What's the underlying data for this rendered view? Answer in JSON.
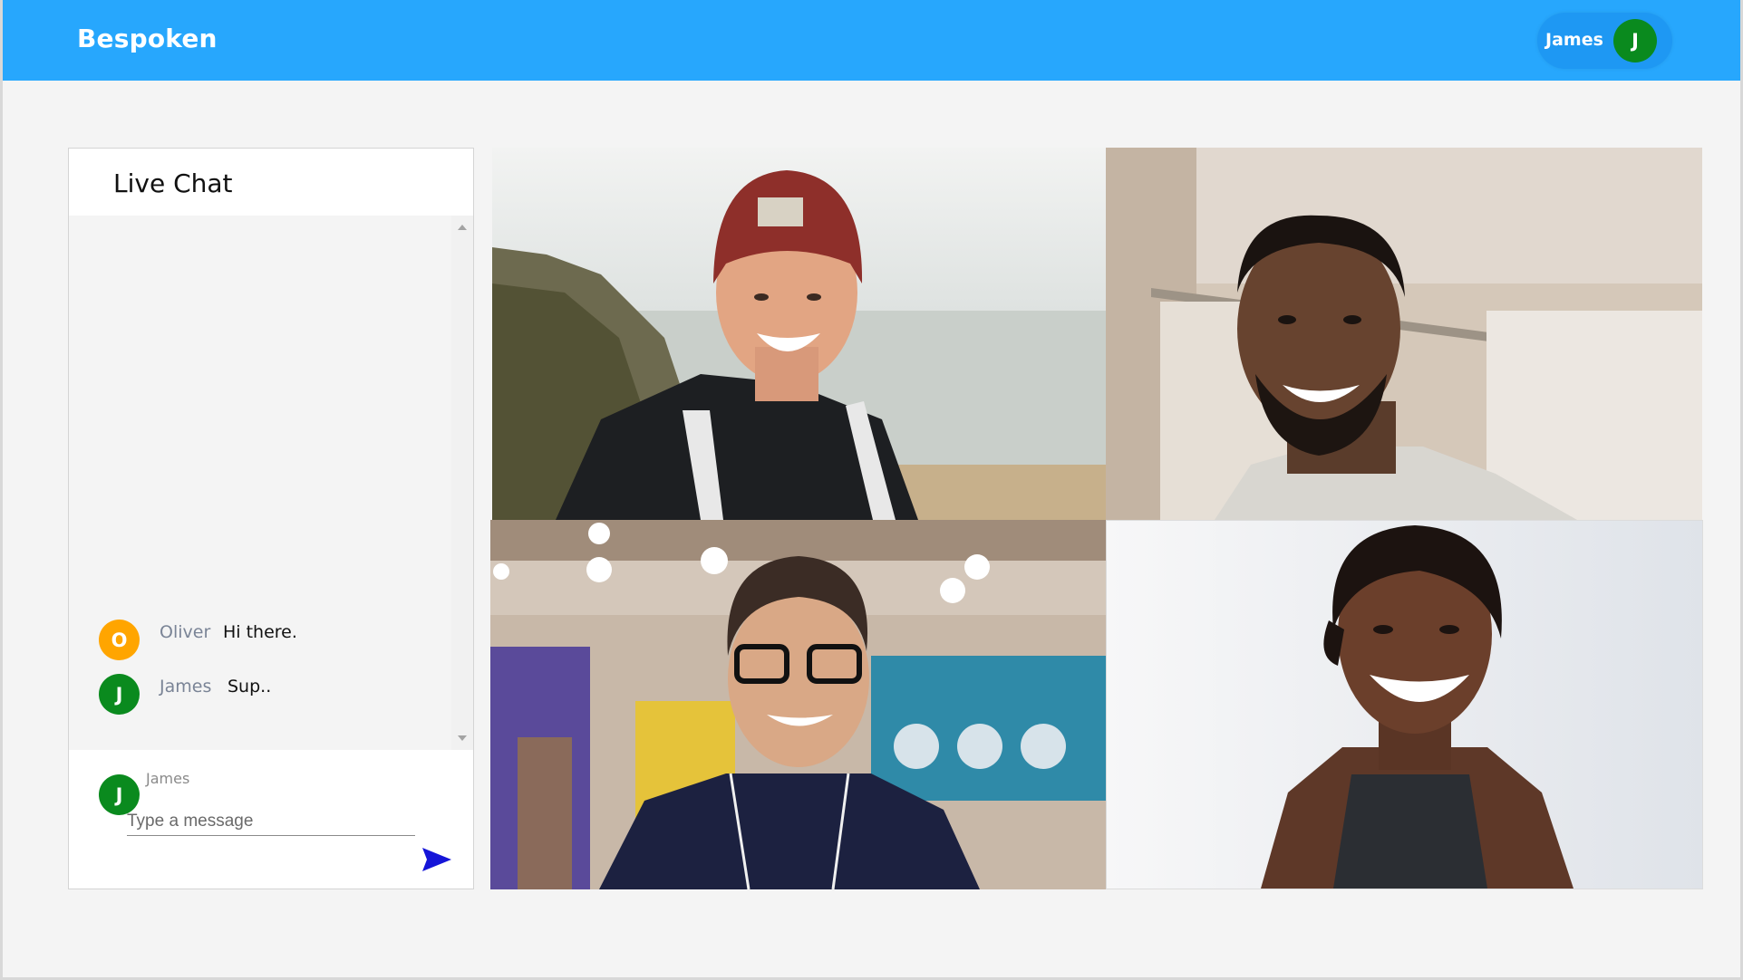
{
  "header": {
    "brand": "Bespoken",
    "user_name": "James",
    "user_initial": "J"
  },
  "chat": {
    "title": "Live Chat",
    "messages": [
      {
        "initial": "O",
        "sender": "Oliver",
        "text": "Hi there.",
        "avatar_color": "#ffa500"
      },
      {
        "initial": "J",
        "sender": "James",
        "text": "Sup..",
        "avatar_color": "#0a8a1e"
      }
    ],
    "composer": {
      "initial": "J",
      "sender": "James",
      "placeholder": "Type a message",
      "avatar_color": "#0a8a1e"
    },
    "send_icon": "send-icon"
  },
  "video_grid": {
    "tiles": [
      {
        "description": "participant-1",
        "icon": "video-feed"
      },
      {
        "description": "participant-2",
        "icon": "video-feed"
      },
      {
        "description": "participant-3",
        "icon": "video-feed"
      },
      {
        "description": "participant-4",
        "icon": "video-feed"
      }
    ]
  },
  "colors": {
    "header_bg": "#27a7fd",
    "page_bg": "#f4f4f4",
    "send_icon": "#1515d8"
  }
}
